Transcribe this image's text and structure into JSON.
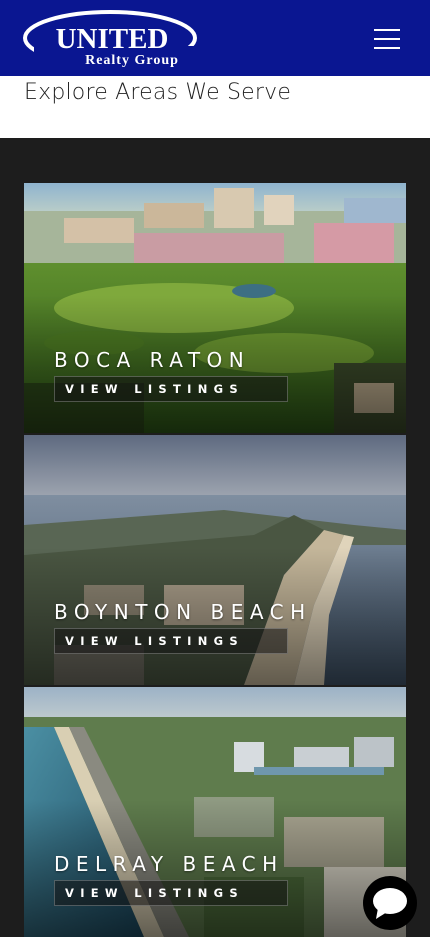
{
  "brand": {
    "name_line1": "UNITED",
    "name_line2": "Realty Group",
    "header_color": "#0a1691"
  },
  "header": {
    "menu_icon": "hamburger-menu-icon"
  },
  "section": {
    "title": "Explore Areas We Serve"
  },
  "areas": [
    {
      "name": "BOCA RATON",
      "cta": "VIEW LISTINGS"
    },
    {
      "name": "BOYNTON BEACH",
      "cta": "VIEW LISTINGS"
    },
    {
      "name": "DELRAY BEACH",
      "cta": "VIEW LISTINGS"
    }
  ],
  "chat": {
    "icon": "chat-bubble-icon"
  }
}
